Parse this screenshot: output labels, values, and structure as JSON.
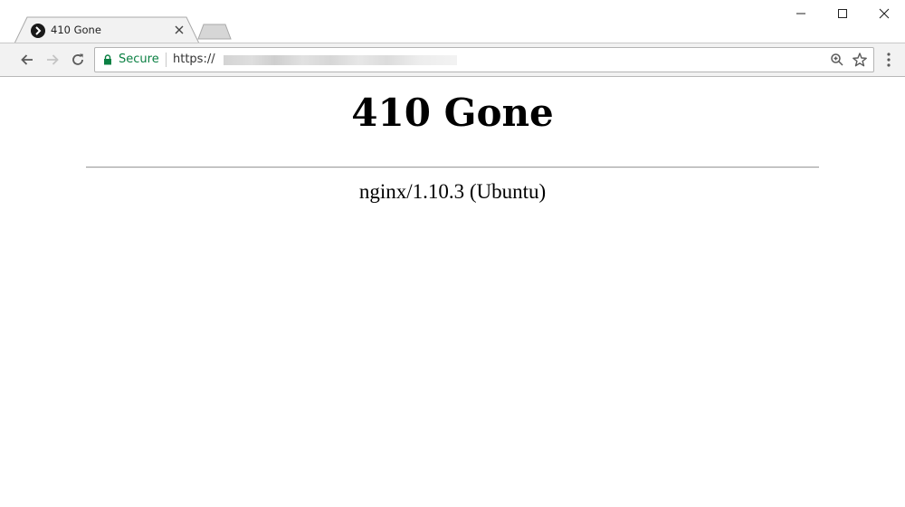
{
  "browser": {
    "tab": {
      "title": "410 Gone"
    },
    "address_bar": {
      "security_label": "Secure",
      "url_prefix": "https://",
      "url_redacted": true
    },
    "icons": {
      "tab_favicon": "chevron-right-icon",
      "tab_close": "close-icon",
      "back": "arrow-left-icon",
      "forward": "arrow-right-icon",
      "reload": "reload-icon",
      "lock": "lock-icon",
      "zoom": "zoom-icon",
      "bookmark": "star-icon",
      "menu": "kebab-menu-icon",
      "minimize": "minimize-icon",
      "maximize": "maximize-icon",
      "close_window": "close-icon"
    },
    "colors": {
      "secure": "#0b8043",
      "toolbar": "#f2f2f2"
    }
  },
  "page": {
    "heading": "410 Gone",
    "server": "nginx/1.10.3 (Ubuntu)"
  }
}
